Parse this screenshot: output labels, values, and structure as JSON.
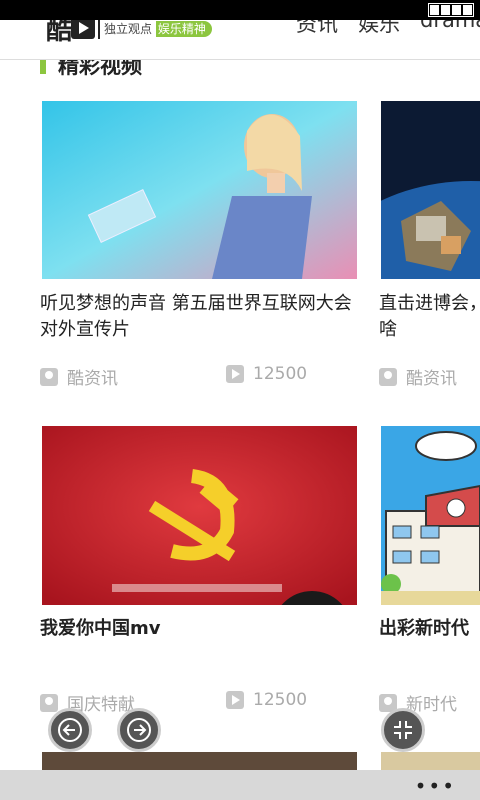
{
  "header": {
    "logo_mark": "酷",
    "logo_tagline": "独立观点",
    "logo_tagline_badge": "娱乐精神",
    "nav_items": [
      "资讯",
      "娱乐",
      "drama"
    ]
  },
  "section": {
    "title": "精彩视频"
  },
  "cards": [
    {
      "title": "听见梦想的声音 第五届世界互联网大会对外宣传片",
      "author": "酷资讯",
      "plays": "12500"
    },
    {
      "title": "直击进博会，",
      "title2": "啥",
      "author": "酷资讯"
    },
    {
      "title": "我爱你中国mv",
      "author": "国庆特献",
      "plays": "12500"
    },
    {
      "title": "出彩新时代",
      "author": "新时代"
    }
  ],
  "appbar": {
    "more": "•••"
  },
  "colors": {
    "accent": "#8cc63f",
    "status_bg": "#000000",
    "appbar_bg": "#d8d8d8"
  }
}
